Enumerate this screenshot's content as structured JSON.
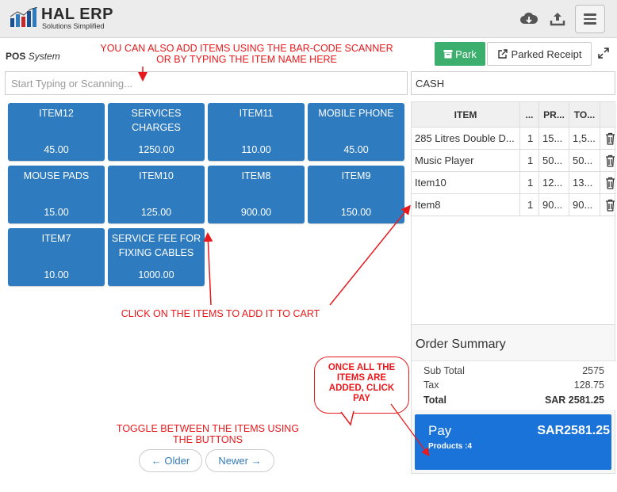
{
  "header": {
    "logo_title": "HAL ERP",
    "logo_subtitle": "Solutions Simplified",
    "icons": [
      "cloud-download-icon",
      "upload-icon",
      "hamburger-menu-icon"
    ]
  },
  "pos": {
    "label_bold": "POS",
    "label_italic": "System",
    "park_label": "Park",
    "parked_receipt_label": "Parked Receipt",
    "search_placeholder": "Start Typing or Scanning...",
    "customer_value": "CASH"
  },
  "items": [
    {
      "name": "ITEM12",
      "price": "45.00"
    },
    {
      "name": "SERVICES CHARGES",
      "price": "1250.00"
    },
    {
      "name": "ITEM11",
      "price": "110.00"
    },
    {
      "name": "MOBILE PHONE",
      "price": "45.00"
    },
    {
      "name": "MOUSE PADS",
      "price": "15.00"
    },
    {
      "name": "ITEM10",
      "price": "125.00"
    },
    {
      "name": "ITEM8",
      "price": "900.00"
    },
    {
      "name": "ITEM9",
      "price": "150.00"
    },
    {
      "name": "ITEM7",
      "price": "10.00"
    },
    {
      "name": "SERVICE FEE FOR FIXING CABLES",
      "price": "1000.00"
    }
  ],
  "cart": {
    "headers": [
      "ITEM",
      "...",
      "PR...",
      "TO..."
    ],
    "rows": [
      {
        "item": "285 Litres Double D...",
        "qty": "1",
        "price": "15...",
        "total": "1,5..."
      },
      {
        "item": "Music Player",
        "qty": "1",
        "price": "50...",
        "total": "50..."
      },
      {
        "item": "Item10",
        "qty": "1",
        "price": "12...",
        "total": "13..."
      },
      {
        "item": "Item8",
        "qty": "1",
        "price": "90...",
        "total": "90..."
      }
    ]
  },
  "summary": {
    "title": "Order Summary",
    "subtotal_label": "Sub Total",
    "subtotal_value": "2575",
    "tax_label": "Tax",
    "tax_value": "128.75",
    "total_label": "Total",
    "total_value": "SAR 2581.25"
  },
  "pay": {
    "label": "Pay",
    "amount": "SAR2581.25",
    "products": "Products :4"
  },
  "pagination": {
    "older": "← Older",
    "newer": "Newer →"
  },
  "annotations": {
    "scanner_line1": "YOU CAN ALSO ADD ITEMS USING THE BAR-CODE SCANNER",
    "scanner_line2": "OR BY TYPING THE ITEM NAME HERE",
    "click_items": "CLICK ON THE ITEMS TO ADD IT TO CART",
    "bubble": "ONCE ALL THE ITEMS ARE ADDED, CLICK PAY",
    "toggle_line1": "TOGGLE BETWEEN THE ITEMS USING",
    "toggle_line2": "THE BUTTONS"
  },
  "colors": {
    "tile": "#2e7bbf",
    "park": "#3cae6e",
    "pay": "#1a73d8",
    "annotation": "#e8191c"
  }
}
